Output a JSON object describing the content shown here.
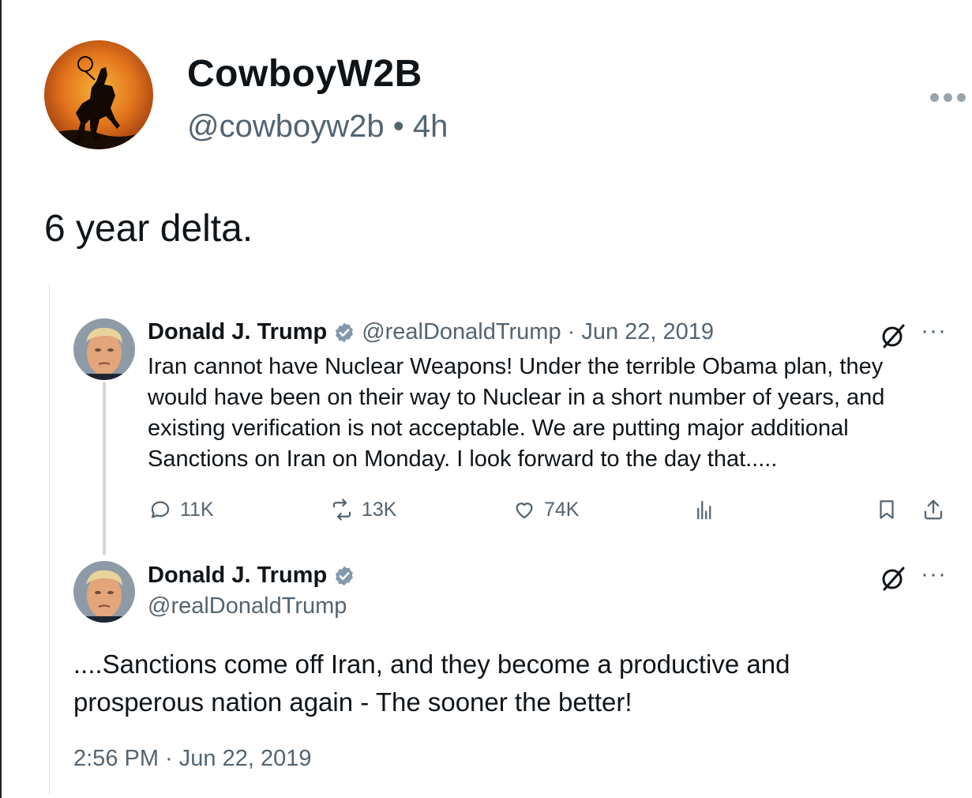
{
  "outer_post": {
    "display_name": "CowboyW2B",
    "handle": "@cowboyw2b",
    "separator": "•",
    "age": "4h",
    "text": "6 year delta."
  },
  "quoted_thread": {
    "tweet1": {
      "display_name": "Donald J. Trump",
      "handle_date": "@realDonaldTrump · Jun 22, 2019",
      "text": "Iran cannot have Nuclear Weapons! Under the terrible Obama plan, they would have been on their way to Nuclear in a short number of years, and existing verification is not acceptable. We are putting major additional Sanctions on Iran on Monday. I look forward to the day that.....",
      "replies": "11K",
      "reposts": "13K",
      "likes": "74K"
    },
    "tweet2": {
      "display_name": "Donald J. Trump",
      "handle": "@realDonaldTrump",
      "text": "....Sanctions come off Iran, and they become a productive and prosperous nation again - The sooner the better!",
      "timestamp": "2:56 PM · Jun 22, 2019"
    },
    "more_glyph": "···"
  },
  "colors": {
    "text": "#0f1419",
    "muted": "#536471",
    "verified_badge": "#829aab",
    "thread_line": "#cfd9de"
  },
  "icons": [
    "cowboy-avatar",
    "trump-avatar",
    "verified-badge-icon",
    "grok-icon",
    "reply-icon",
    "repost-icon",
    "like-icon",
    "views-icon",
    "bookmark-icon",
    "share-icon",
    "more-icon"
  ]
}
